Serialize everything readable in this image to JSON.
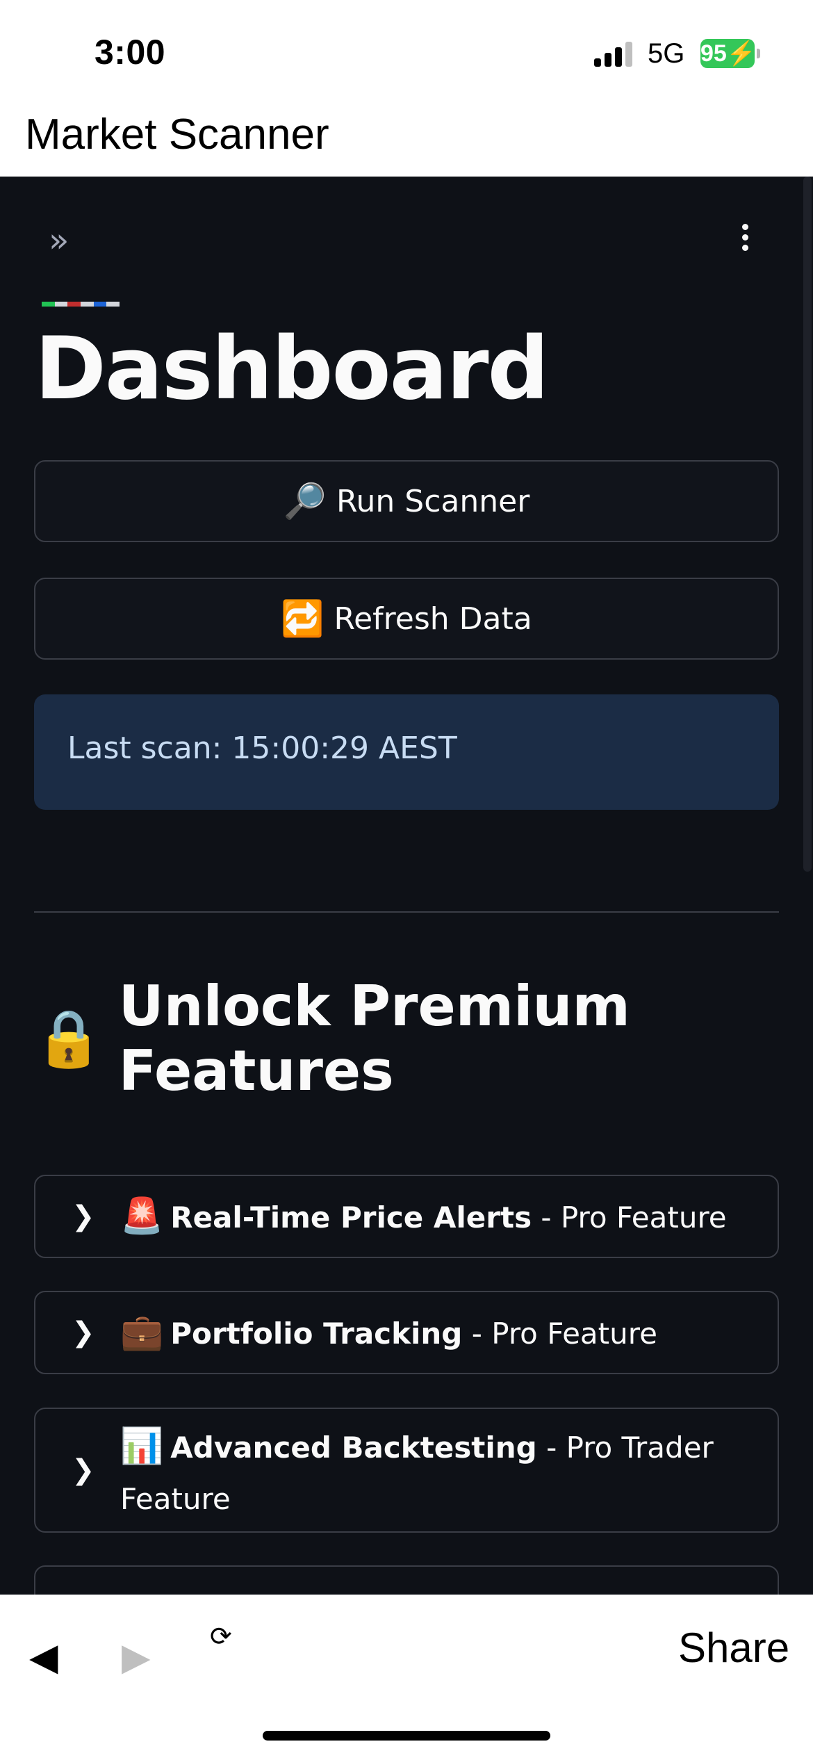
{
  "status_bar": {
    "time": "3:00",
    "network": "5G",
    "battery": "95"
  },
  "browser": {
    "page_title": "Market Scanner"
  },
  "app": {
    "heading": "Dashboard",
    "run_button": {
      "icon": "magnifying-glass-icon",
      "emoji": "🔎",
      "label": "Run Scanner"
    },
    "refresh_button": {
      "icon": "repeat-icon",
      "emoji": "🔁",
      "label": "Refresh Data"
    },
    "info": {
      "text": "Last scan: 15:00:29 AEST",
      "color": "#1b2c45"
    },
    "premium_section": {
      "emoji": "🔒",
      "title": "Unlock Premium Features"
    },
    "expanders": [
      {
        "emoji": "🚨",
        "title": "Real-Time Price Alerts",
        "suffix": " - Pro Feature"
      },
      {
        "emoji": "💼",
        "title": "Portfolio Tracking",
        "suffix": " - Pro Feature"
      },
      {
        "emoji": "📊",
        "title": "Advanced Backtesting",
        "suffix": " - Pro Trader Feature"
      }
    ],
    "colors": {
      "background": "#0e1117",
      "text": "#fafafa",
      "border": "#3a3d46"
    }
  },
  "toolbar": {
    "back_icon": "◀",
    "forward_icon": "▶",
    "reload_icon": "⟳",
    "share_label": "Share"
  }
}
